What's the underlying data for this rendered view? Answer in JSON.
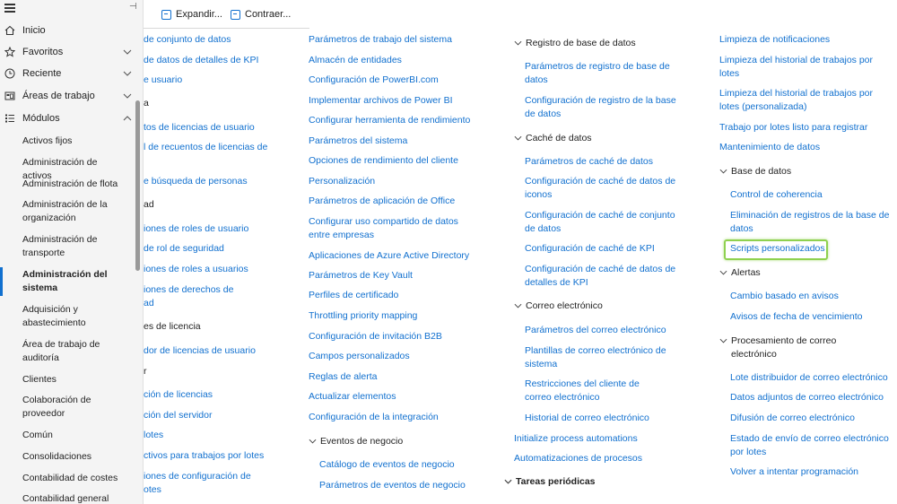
{
  "sidebar": {
    "nav": [
      {
        "label": "Inicio",
        "icon": "home-icon"
      },
      {
        "label": "Favoritos",
        "icon": "star-icon"
      },
      {
        "label": "Reciente",
        "icon": "clock-icon"
      },
      {
        "label": "Áreas de trabajo",
        "icon": "workspace-icon"
      },
      {
        "label": "Módulos",
        "icon": "list-icon"
      }
    ],
    "modules": [
      "Activos fijos",
      "Administración de activos",
      "Administración de flota",
      "Administración de la organización",
      "Administración de transporte",
      "Administración del sistema",
      "Adquisición y abastecimiento",
      "Área de trabajo de auditoría",
      "Clientes",
      "Colaboración de proveedor",
      "Común",
      "Consolidaciones",
      "Contabilidad de costes",
      "Contabilidad general"
    ]
  },
  "toolbar": {
    "expand": "Expandir...",
    "collapse": "Contraer..."
  },
  "col1": [
    "de conjunto de datos",
    "de datos de detalles de KPI",
    "e usuario",
    "a",
    "tos de licencias de usuario",
    "l de recuentos de licencias de",
    "e búsqueda de personas",
    "ad",
    "iones de roles de usuario",
    "de rol de seguridad",
    "iones de roles a usuarios",
    "iones de derechos de",
    "ad",
    "es de licencia",
    "dor de licencias de usuario",
    "r",
    "ción de licencias",
    "ción del servidor",
    "lotes",
    "ctivos para trabajos por lotes",
    "iones de configuración de",
    "otes"
  ],
  "col2": [
    "Parámetros de trabajo del sistema",
    "Almacén de entidades",
    "Configuración de PowerBI.com",
    "Implementar archivos de Power BI",
    "Configurar herramienta de rendimiento",
    "Parámetros del sistema",
    "Opciones de rendimiento del cliente",
    "Personalización",
    "Parámetros de aplicación de Office",
    "Configurar uso compartido de datos entre empresas",
    "Aplicaciones de Azure Active Directory",
    "Parámetros de Key Vault",
    "Perfiles de certificado",
    "Throttling priority mapping",
    "Configuración de invitación B2B",
    "Campos personalizados",
    "Reglas de alerta",
    "Actualizar elementos",
    "Configuración de la integración"
  ],
  "col2_group": {
    "title": "Eventos de negocio",
    "items": [
      "Catálogo de eventos de negocio",
      "Parámetros de eventos de negocio"
    ]
  },
  "col3": {
    "g1": {
      "title": "Registro de base de datos",
      "items": [
        "Parámetros de registro de base de datos",
        "Configuración de registro de la base de datos"
      ]
    },
    "g2": {
      "title": "Caché de datos",
      "items": [
        "Parámetros de caché de datos",
        "Configuración de caché de datos de iconos",
        "Configuración de caché de conjunto de datos",
        "Configuración de caché de KPI",
        "Configuración de caché de datos de detalles de KPI"
      ]
    },
    "g3": {
      "title": "Correo electrónico",
      "items": [
        "Parámetros del correo electrónico",
        "Plantillas de correo electrónico de sistema",
        "Restricciones del cliente de correo electrónico",
        "Historial de correo electrónico"
      ]
    },
    "links": [
      "Initialize process automations",
      "Automatizaciones de procesos"
    ],
    "g4": {
      "title": "Tareas periódicas"
    }
  },
  "col4": {
    "links": [
      "Limpieza de notificaciones",
      "Limpieza del historial de trabajos por lotes",
      "Limpieza del historial de trabajos por lotes (personalizada)",
      "Trabajo por lotes listo para registrar",
      "Mantenimiento de datos"
    ],
    "g1": {
      "title": "Base de datos",
      "items": [
        "Control de coherencia",
        "Eliminación de registros de la base de datos",
        "Scripts personalizados"
      ]
    },
    "g2": {
      "title": "Alertas",
      "items": [
        "Cambio basado en avisos",
        "Avisos de fecha de vencimiento"
      ]
    },
    "g3": {
      "title": "Procesamiento de correo electrónico",
      "items": [
        "Lote distribuidor de correo electrónico",
        "Datos adjuntos de correo electrónico",
        "Difusión de correo electrónico",
        "Estado de envío de correo electrónico por lotes",
        "Volver a intentar programación"
      ]
    }
  }
}
